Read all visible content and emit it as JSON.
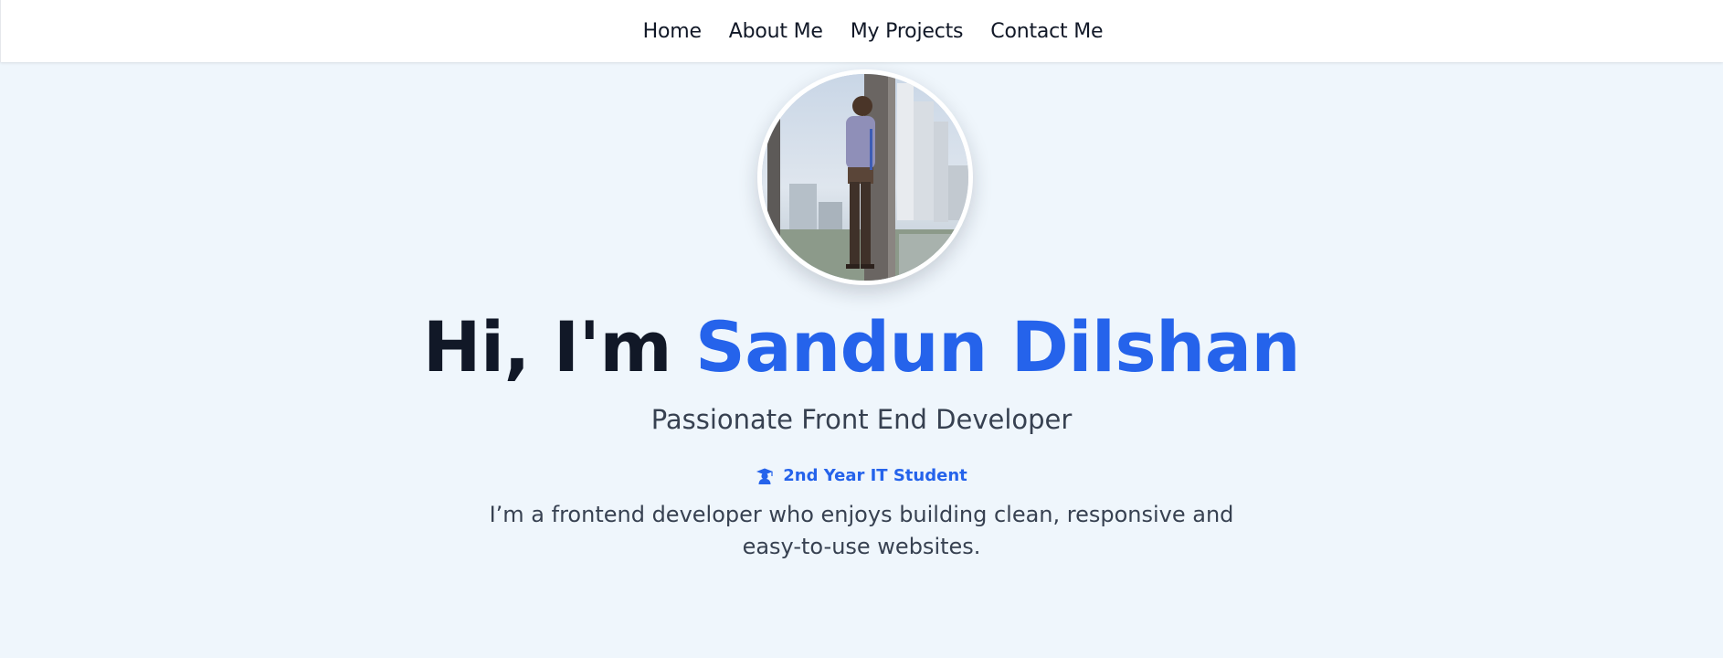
{
  "nav": {
    "items": [
      {
        "label": "Home"
      },
      {
        "label": "About Me"
      },
      {
        "label": "My Projects"
      },
      {
        "label": "Contact Me"
      }
    ]
  },
  "hero": {
    "avatar_icon": "profile-photo",
    "greeting": "Hi, I'm ",
    "name": "Sandun Dilshan",
    "subtitle": "Passionate Front End Developer",
    "badge": {
      "icon": "graduation-student-icon",
      "label": "2nd Year IT Student"
    },
    "bio": "I’m a frontend developer who enjoys building clean, responsive and easy-to-use websites."
  },
  "colors": {
    "accent": "#2563eb",
    "background": "#eff6fc",
    "heading": "#111827",
    "body_text": "#374151"
  }
}
